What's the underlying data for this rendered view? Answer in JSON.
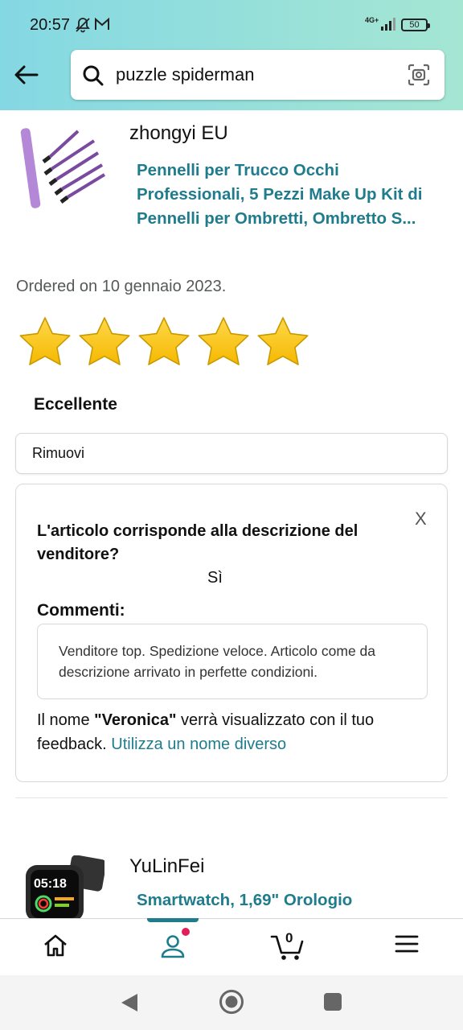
{
  "status_bar": {
    "time": "20:57",
    "network": "4G+",
    "battery": "50"
  },
  "search": {
    "value": "puzzle spiderman"
  },
  "review_item": {
    "seller": "zhongyi EU",
    "title": "Pennelli per Trucco Occhi Professionali, 5 Pezzi Make Up Kit di Pennelli per Ombretti, Ombretto S...",
    "ordered": "Ordered on 10 gennaio 2023.",
    "rating": 5,
    "rating_max": 5,
    "rating_label": "Eccellente",
    "remove_label": "Rimuovi"
  },
  "feedback_card": {
    "close_label": "X",
    "question": "L'articolo corrisponde alla descrizione del venditore?",
    "answer": "Sì",
    "comments_label": "Commenti:",
    "comment_text": "Venditore top. Spedizione veloce. Articolo come da descrizione arrivato in perfette condizioni.",
    "note_prefix": "Il nome ",
    "note_name": "\"Veronica\"",
    "note_suffix": " verrà visualizzato con il tuo feedback. ",
    "note_link": "Utilizza un nome diverso"
  },
  "next_item": {
    "seller": "YuLinFei",
    "title": "Smartwatch, 1,69\" Orologio",
    "watch_time": "05:18"
  },
  "bottom_nav": {
    "cart_count": "0",
    "accent": "#1f7c8c",
    "badge_color": "#e01e5a",
    "items": [
      "home-icon",
      "account-icon",
      "cart-icon",
      "menu-icon"
    ]
  },
  "colors": {
    "link": "#1f7c8c",
    "star": "#f5b800",
    "header_start": "#84d8e3",
    "header_end": "#a5e6d3"
  }
}
